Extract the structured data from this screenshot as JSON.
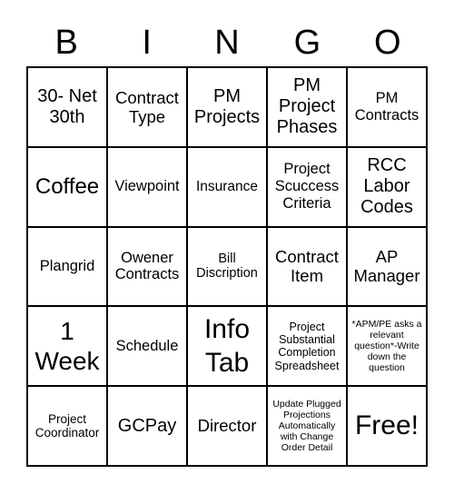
{
  "header": [
    "B",
    "I",
    "N",
    "G",
    "O"
  ],
  "cells": [
    "30- Net 30th",
    "Contract Type",
    "PM Projects",
    "PM Project Phases",
    "PM Contracts",
    "Coffee",
    "Viewpoint",
    "Insurance",
    "Project Scuccess Criteria",
    "RCC Labor Codes",
    "Plangrid",
    "Owener Contracts",
    "Bill Discription",
    "Contract Item",
    "AP Manager",
    "1 Week",
    "Schedule",
    "Info Tab",
    "Project Substantial Completion Spreadsheet",
    "*APM/PE asks a relevant question*-Write down the question",
    "Project Coordinator",
    "GCPay",
    "Director",
    "Update Plugged Projections Automatically with Change Order Detail",
    "Free!"
  ]
}
